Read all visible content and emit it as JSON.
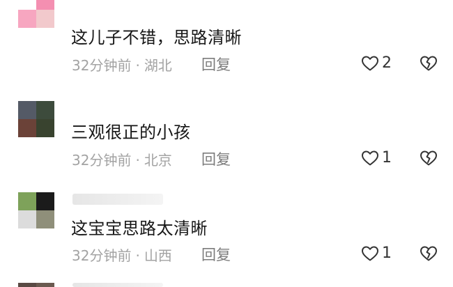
{
  "comments": [
    {
      "text": "这儿子不错，思路清晰",
      "time": "32分钟前",
      "sep": "·",
      "location": "湖北",
      "reply": "回复",
      "likes": "2",
      "avatar_colors": [
        "#ffffff",
        "#f48fb1",
        "#f7a6c0",
        "#f2c9cc"
      ]
    },
    {
      "text": "三观很正的小孩",
      "time": "32分钟前",
      "sep": "·",
      "location": "北京",
      "reply": "回复",
      "likes": "1",
      "avatar_colors": [
        "#545a66",
        "#3d4b3c",
        "#6b4238",
        "#39432f"
      ]
    },
    {
      "text": "这宝宝思路太清晰",
      "time": "32分钟前",
      "sep": "·",
      "location": "山西",
      "reply": "回复",
      "likes": "1",
      "avatar_colors": [
        "#7ea25a",
        "#1b1b1b",
        "#dcdcdc",
        "#8f8f7a"
      ]
    }
  ],
  "colors": {
    "meta": "#a3a3a3",
    "reply": "#7c7c7c",
    "text": "#161616",
    "icon": "#333333"
  },
  "icons": {
    "like": "heart-outline-icon",
    "dislike": "broken-heart-icon"
  }
}
